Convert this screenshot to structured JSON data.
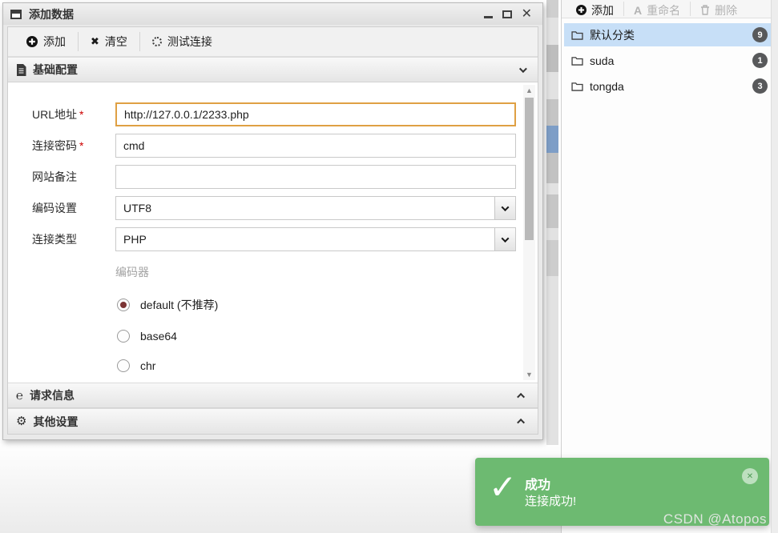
{
  "dialog": {
    "title": "添加数据",
    "window_controls": {
      "close": "✕"
    },
    "toolbar": {
      "add": "添加",
      "clear": "清空",
      "clear_icon": "✖",
      "test": "测试连接"
    },
    "sections": {
      "basic": {
        "label": "基础配置"
      },
      "request": {
        "label": "请求信息",
        "icon_glyph": "℮"
      },
      "other": {
        "label": "其他设置",
        "icon_glyph": "⚙"
      }
    },
    "form": {
      "required_marker": "*",
      "url": {
        "label": "URL地址",
        "value": "http://127.0.0.1/2233.php"
      },
      "password": {
        "label": "连接密码",
        "value": "cmd"
      },
      "note": {
        "label": "网站备注",
        "value": ""
      },
      "encoding": {
        "label": "编码设置",
        "value": "UTF8"
      },
      "conn_type": {
        "label": "连接类型",
        "value": "PHP"
      },
      "encoder_label": "编码器",
      "encoders": [
        {
          "label": "default (不推荐)",
          "selected": true
        },
        {
          "label": "base64",
          "selected": false
        },
        {
          "label": "chr",
          "selected": false
        }
      ]
    },
    "scrollbar": {
      "up": "▲",
      "down": "▼"
    }
  },
  "sidebar": {
    "toolbar": {
      "add": "添加",
      "rename": "重命名",
      "rename_icon": "A",
      "delete": "删除"
    },
    "categories": [
      {
        "label": "默认分类",
        "count": "9",
        "selected": true
      },
      {
        "label": "suda",
        "count": "1",
        "selected": false
      },
      {
        "label": "tongda",
        "count": "3",
        "selected": false
      }
    ]
  },
  "toast": {
    "title": "成功",
    "message": "连接成功!",
    "check": "✓",
    "close": "✕"
  },
  "watermark": "CSDN @Atopos",
  "colors": {
    "toast_green": "#6dba71",
    "selection_blue": "#c7dff7",
    "focus_orange": "#dfa043",
    "badge_gray": "#58595b",
    "required_red": "#cc0000"
  }
}
